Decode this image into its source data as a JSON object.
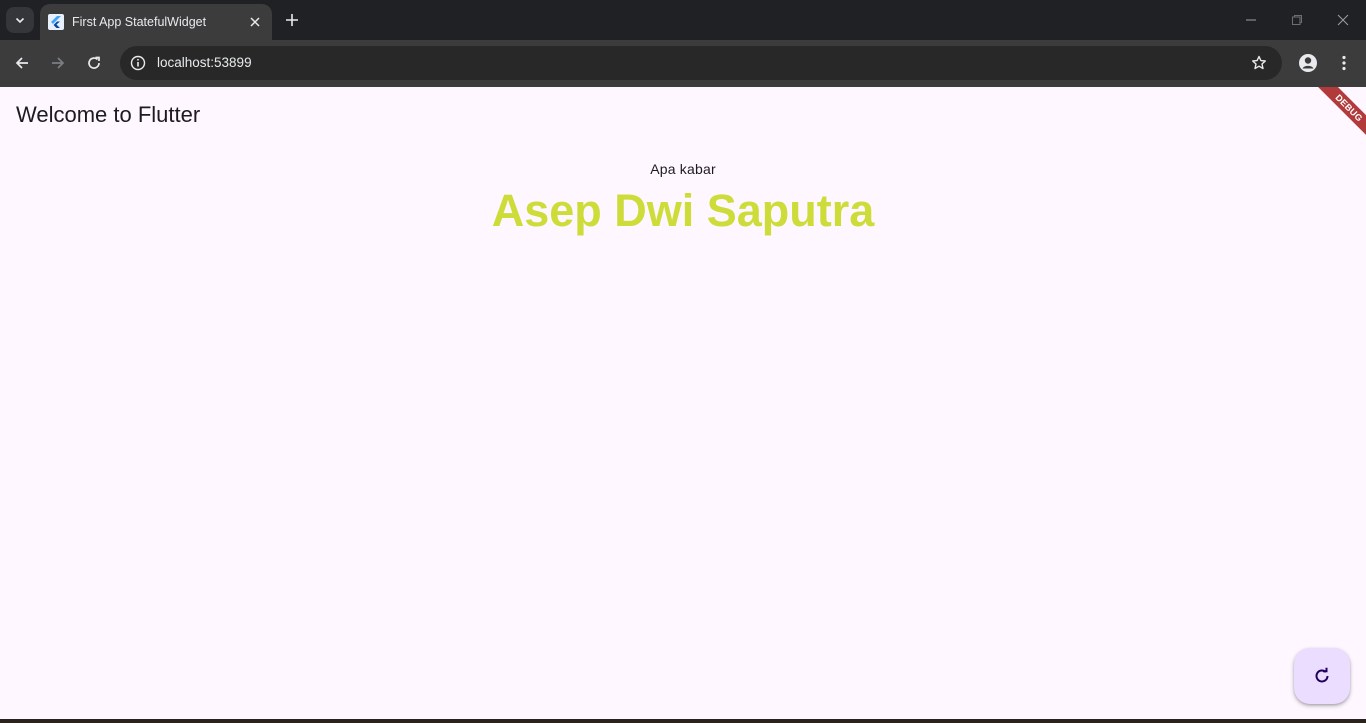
{
  "browser": {
    "tab": {
      "title": "First App StatefulWidget",
      "favicon": "flutter-logo"
    },
    "address": {
      "url": "localhost:53899"
    },
    "icons": {
      "tab_search": "chevron-down-icon",
      "tab_close": "close-icon",
      "new_tab": "plus-icon",
      "minimize": "minimize-icon",
      "restore": "restore-icon",
      "close_window": "close-icon",
      "back": "arrow-left-icon",
      "forward": "arrow-right-icon",
      "reload": "reload-icon",
      "site_info": "info-icon",
      "bookmark": "star-icon",
      "profile": "profile-icon",
      "menu": "kebab-menu-icon"
    }
  },
  "app": {
    "title": "Welcome to Flutter",
    "greeting": "Apa kabar",
    "name": "Asep Dwi Saputra",
    "name_color": "#cddc39",
    "debug_banner": "DEBUG",
    "fab_icon": "refresh-icon",
    "background": "#fef7ff",
    "fab_color": "#eaddff"
  }
}
